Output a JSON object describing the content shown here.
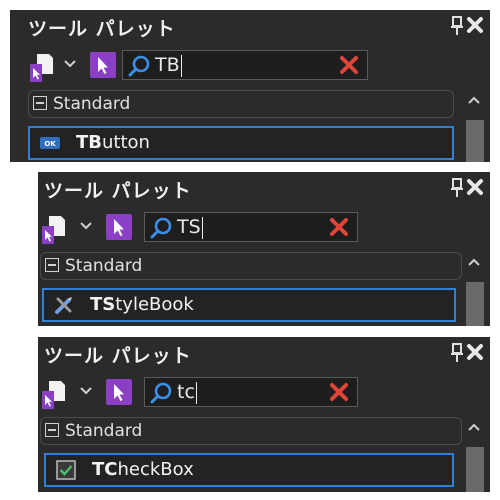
{
  "panels": [
    {
      "title": "ツール パレット",
      "search_text": "TB",
      "category": "Standard",
      "item": {
        "bold": "TB",
        "rest": "utton",
        "icon": "button-component-icon"
      }
    },
    {
      "title": "ツール パレット",
      "search_text": "TS",
      "category": "Standard",
      "item": {
        "bold": "TS",
        "rest": "tyleBook",
        "icon": "stylebook-component-icon"
      }
    },
    {
      "title": "ツール パレット",
      "search_text": "tc",
      "category": "Standard",
      "item": {
        "bold": "TC",
        "rest": "heckBox",
        "icon": "checkbox-component-icon"
      }
    }
  ],
  "button_icon_text": "OK",
  "colors": {
    "panel_bg": "#2b2b2b",
    "accent_purple": "#8b3fc4",
    "selection_blue": "#2f7fd6",
    "clear_red": "#e0453a",
    "search_icon_blue": "#3a8fe8"
  }
}
